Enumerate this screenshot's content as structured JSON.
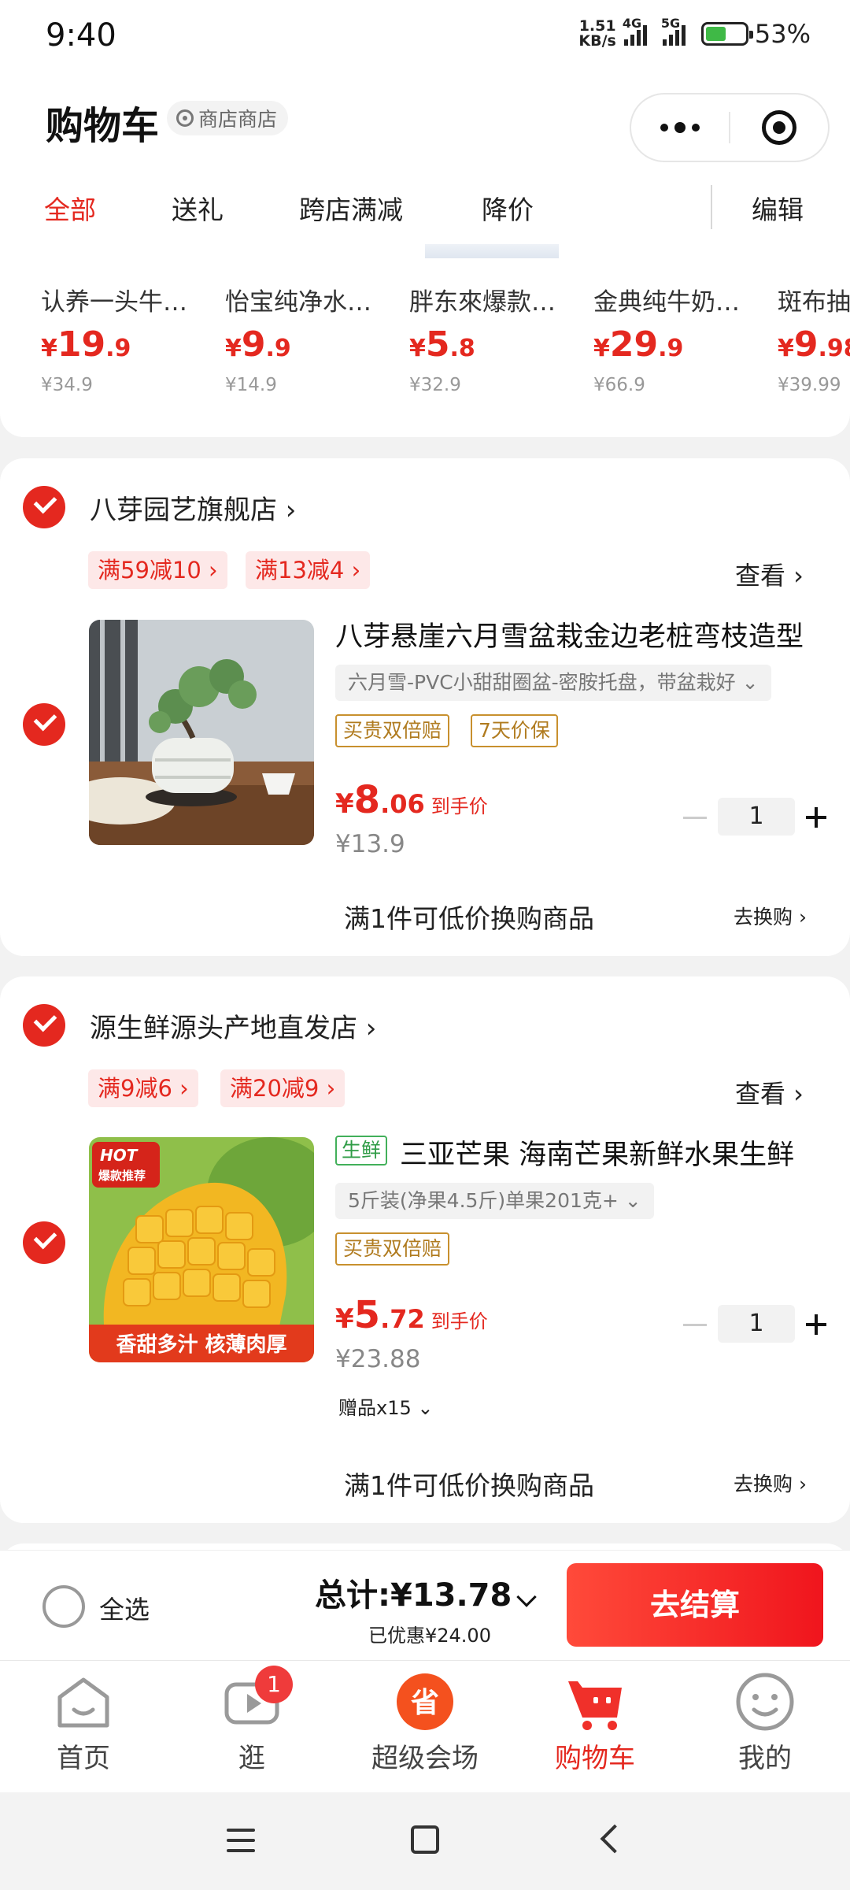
{
  "status_bar": {
    "time": "9:40",
    "net_speed_value": "1.51",
    "net_speed_unit": "KB/s",
    "sig1_label": "4G",
    "sig2_label": "5G",
    "battery": "53%"
  },
  "header": {
    "title": "购物车",
    "store_chip": "商店商店"
  },
  "tabs": [
    "全部",
    "送礼",
    "跨店满减",
    "降价"
  ],
  "edit_label": "编辑",
  "recommendations": [
    {
      "name": "认养一头牛…",
      "yen": "¥",
      "int": "19",
      "dec": ".9",
      "old": "¥34.9"
    },
    {
      "name": "怡宝纯净水…",
      "yen": "¥",
      "int": "9",
      "dec": ".9",
      "old": "¥14.9"
    },
    {
      "name": "胖东來爆款…",
      "yen": "¥",
      "int": "5",
      "dec": ".8",
      "old": "¥32.9"
    },
    {
      "name": "金典纯牛奶…",
      "yen": "¥",
      "int": "29",
      "dec": ".9",
      "old": "¥66.9"
    },
    {
      "name": "斑布抽",
      "yen": "¥",
      "int": "9",
      "dec": ".98",
      "old": "¥39.99"
    }
  ],
  "shops": [
    {
      "name": "八芽园艺旗舰店 ›",
      "promos": [
        "满59减10 ›",
        "满13减4 ›"
      ],
      "view": "查看 ›",
      "product": {
        "title": "八芽悬崖六月雪盆栽金边老桩弯枝造型",
        "sku": "六月雪-PVC小甜甜圈盆-密胺托盘，带盆栽好 ⌄",
        "tags": [
          "买贵双倍赔",
          "7天价保"
        ],
        "price_yen": "¥",
        "price_int": "8",
        "price_dec": ".06",
        "price_label": "到手价",
        "old_price": "¥13.9",
        "qty": "1"
      },
      "exchange": "满1件可低价换购商品",
      "exchange_link": "去换购 ›"
    },
    {
      "name": "源生鲜源头产地直发店 ›",
      "promos": [
        "满9减6 ›",
        "满20减9 ›"
      ],
      "view": "查看 ›",
      "product": {
        "fresh_tag": "生鲜",
        "title": "三亚芒果 海南芒果新鲜水果生鲜",
        "sku": "5斤装(净果4.5斤)单果201克+ ⌄",
        "tags": [
          "买贵双倍赔"
        ],
        "price_yen": "¥",
        "price_int": "5",
        "price_dec": ".72",
        "price_label": "到手价",
        "old_price": "¥23.88",
        "qty": "1",
        "gift": "赠品x15 ⌄",
        "img_hot": "HOT",
        "img_badge": "爆款推荐",
        "img_caption": "香甜多汁 核薄肉厚"
      },
      "exchange": "满1件可低价换购商品",
      "exchange_link": "去换购 ›"
    }
  ],
  "checkout_bar": {
    "select_all": "全选",
    "total": "总计:¥13.78",
    "saved": "已优惠¥24.00",
    "checkout": "去结算"
  },
  "nav": [
    {
      "label": "首页"
    },
    {
      "label": "逛",
      "badge": "1"
    },
    {
      "label": "超级会场"
    },
    {
      "label": "购物车"
    },
    {
      "label": "我的"
    }
  ],
  "colors": {
    "accent": "#e4281f",
    "promo_bg": "#fde8e8",
    "tag_gold": "#c8902e",
    "fresh_green": "#42b05a"
  }
}
